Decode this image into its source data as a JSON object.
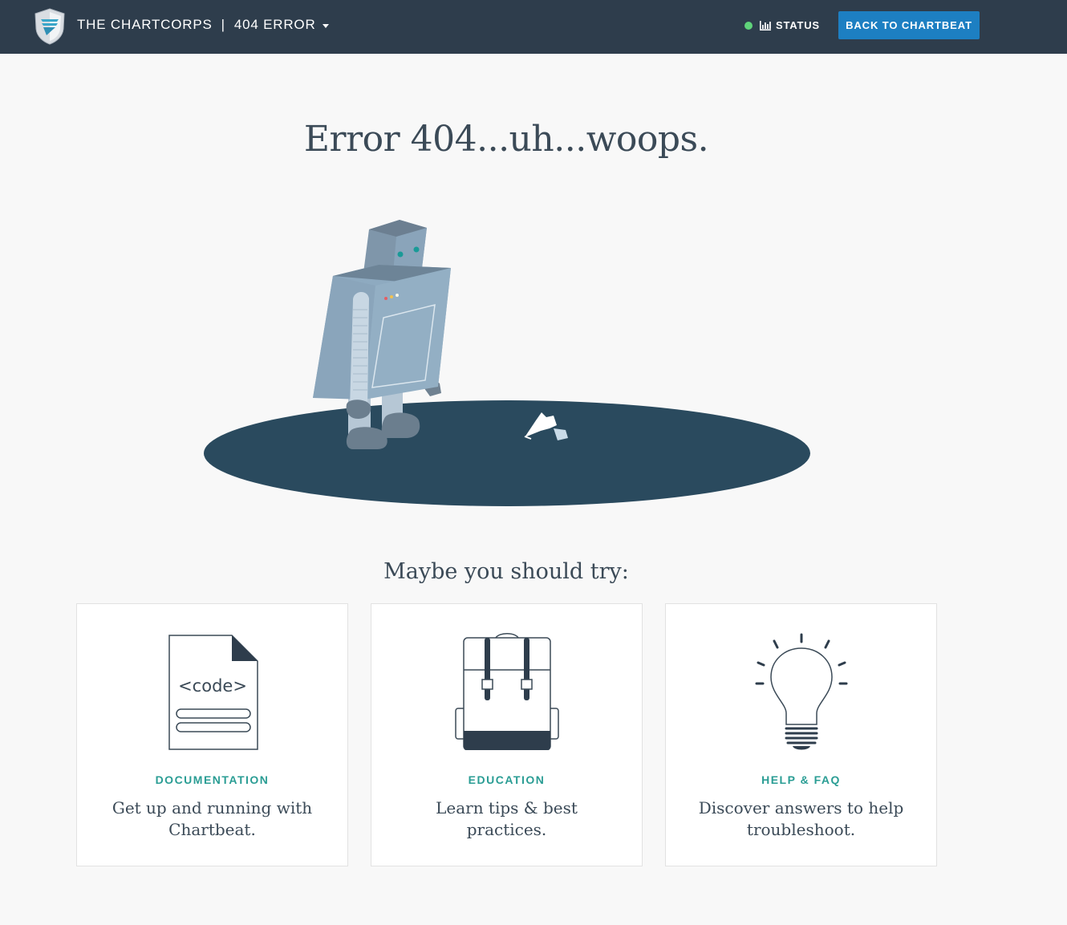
{
  "header": {
    "brand": "THE CHARTCORPS",
    "separator": "|",
    "section": "404 ERROR",
    "status_label": "STATUS",
    "status_color": "#5fd37a",
    "back_button": "BACK TO CHARTBEAT",
    "background": "#2e3d4c",
    "accent": "#1d7fc2"
  },
  "main": {
    "title": "Error 404...uh...woops.",
    "illustration": "robot-with-spotlight",
    "subtitle": "Maybe you should try:"
  },
  "cards": [
    {
      "icon": "document-code-icon",
      "icon_text": "<code>",
      "title": "DOCUMENTATION",
      "description": "Get up and running with Chartbeat."
    },
    {
      "icon": "backpack-icon",
      "title": "EDUCATION",
      "description": "Learn tips & best practices."
    },
    {
      "icon": "lightbulb-icon",
      "title": "HELP & FAQ",
      "description": "Discover answers to help troubleshoot."
    }
  ]
}
